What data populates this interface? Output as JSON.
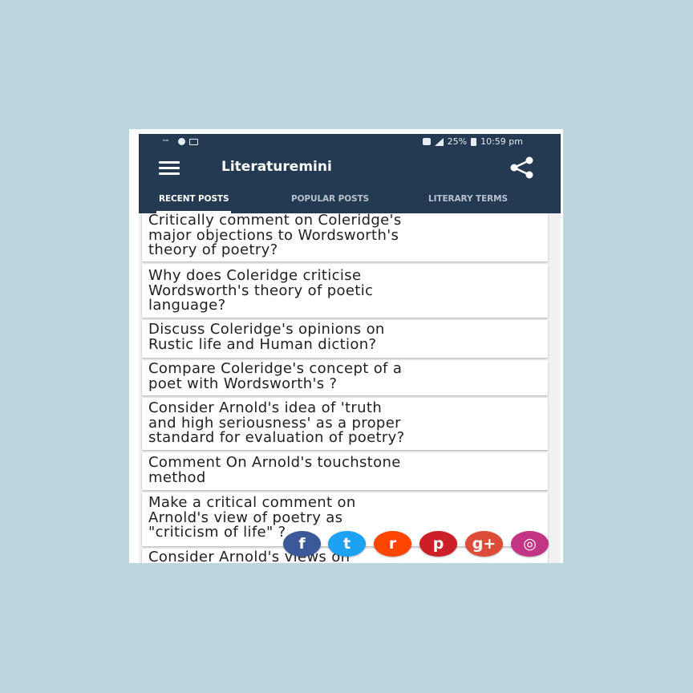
{
  "status_bar": {
    "left_text": "ᵇᵃᵇ",
    "battery_text": "25%",
    "time": "10:59 pm"
  },
  "app_bar": {
    "title": "Literaturemini",
    "menu_icon": "hamburger-menu-icon",
    "share_icon": "share-icon"
  },
  "tabs": [
    {
      "label": "RECENT POSTS",
      "active": true
    },
    {
      "label": "POPULAR POSTS",
      "active": false
    },
    {
      "label": "LITERARY TERMS",
      "active": false
    }
  ],
  "posts": [
    {
      "title": "Critically comment on Coleridge's\nmajor objections to Wordsworth's\ntheory of poetry?"
    },
    {
      "title": "Why does Coleridge criticise\nWordsworth's theory of poetic\nlanguage?"
    },
    {
      "title": "Discuss Coleridge's opinions on\nRustic life and Human diction?"
    },
    {
      "title": "Compare Coleridge's concept of a\npoet with Wordsworth's ?"
    },
    {
      "title": "Consider Arnold's idea of 'truth\nand high seriousness' as a proper\nstandard for evaluation of poetry?"
    },
    {
      "title": "Comment On Arnold's touchstone\nmethod"
    },
    {
      "title": "Make a critical comment on\nArnold's view of poetry as\n\"criticism of life\" ?"
    },
    {
      "title": "Consider Arnold's views on"
    }
  ],
  "social_buttons": [
    {
      "name": "facebook",
      "glyph": "f",
      "color": "#3b5998"
    },
    {
      "name": "twitter",
      "glyph": "t",
      "color": "#1da1f2"
    },
    {
      "name": "reddit",
      "glyph": "r",
      "color": "#ff4500"
    },
    {
      "name": "pinterest",
      "glyph": "p",
      "color": "#cb2027"
    },
    {
      "name": "google-plus",
      "glyph": "g+",
      "color": "#dd4b39"
    },
    {
      "name": "instagram",
      "glyph": "◎",
      "color": "#c13584"
    }
  ],
  "colors": {
    "background": "#bdd5dd",
    "app_bar": "#243a52",
    "card": "#ffffff"
  }
}
